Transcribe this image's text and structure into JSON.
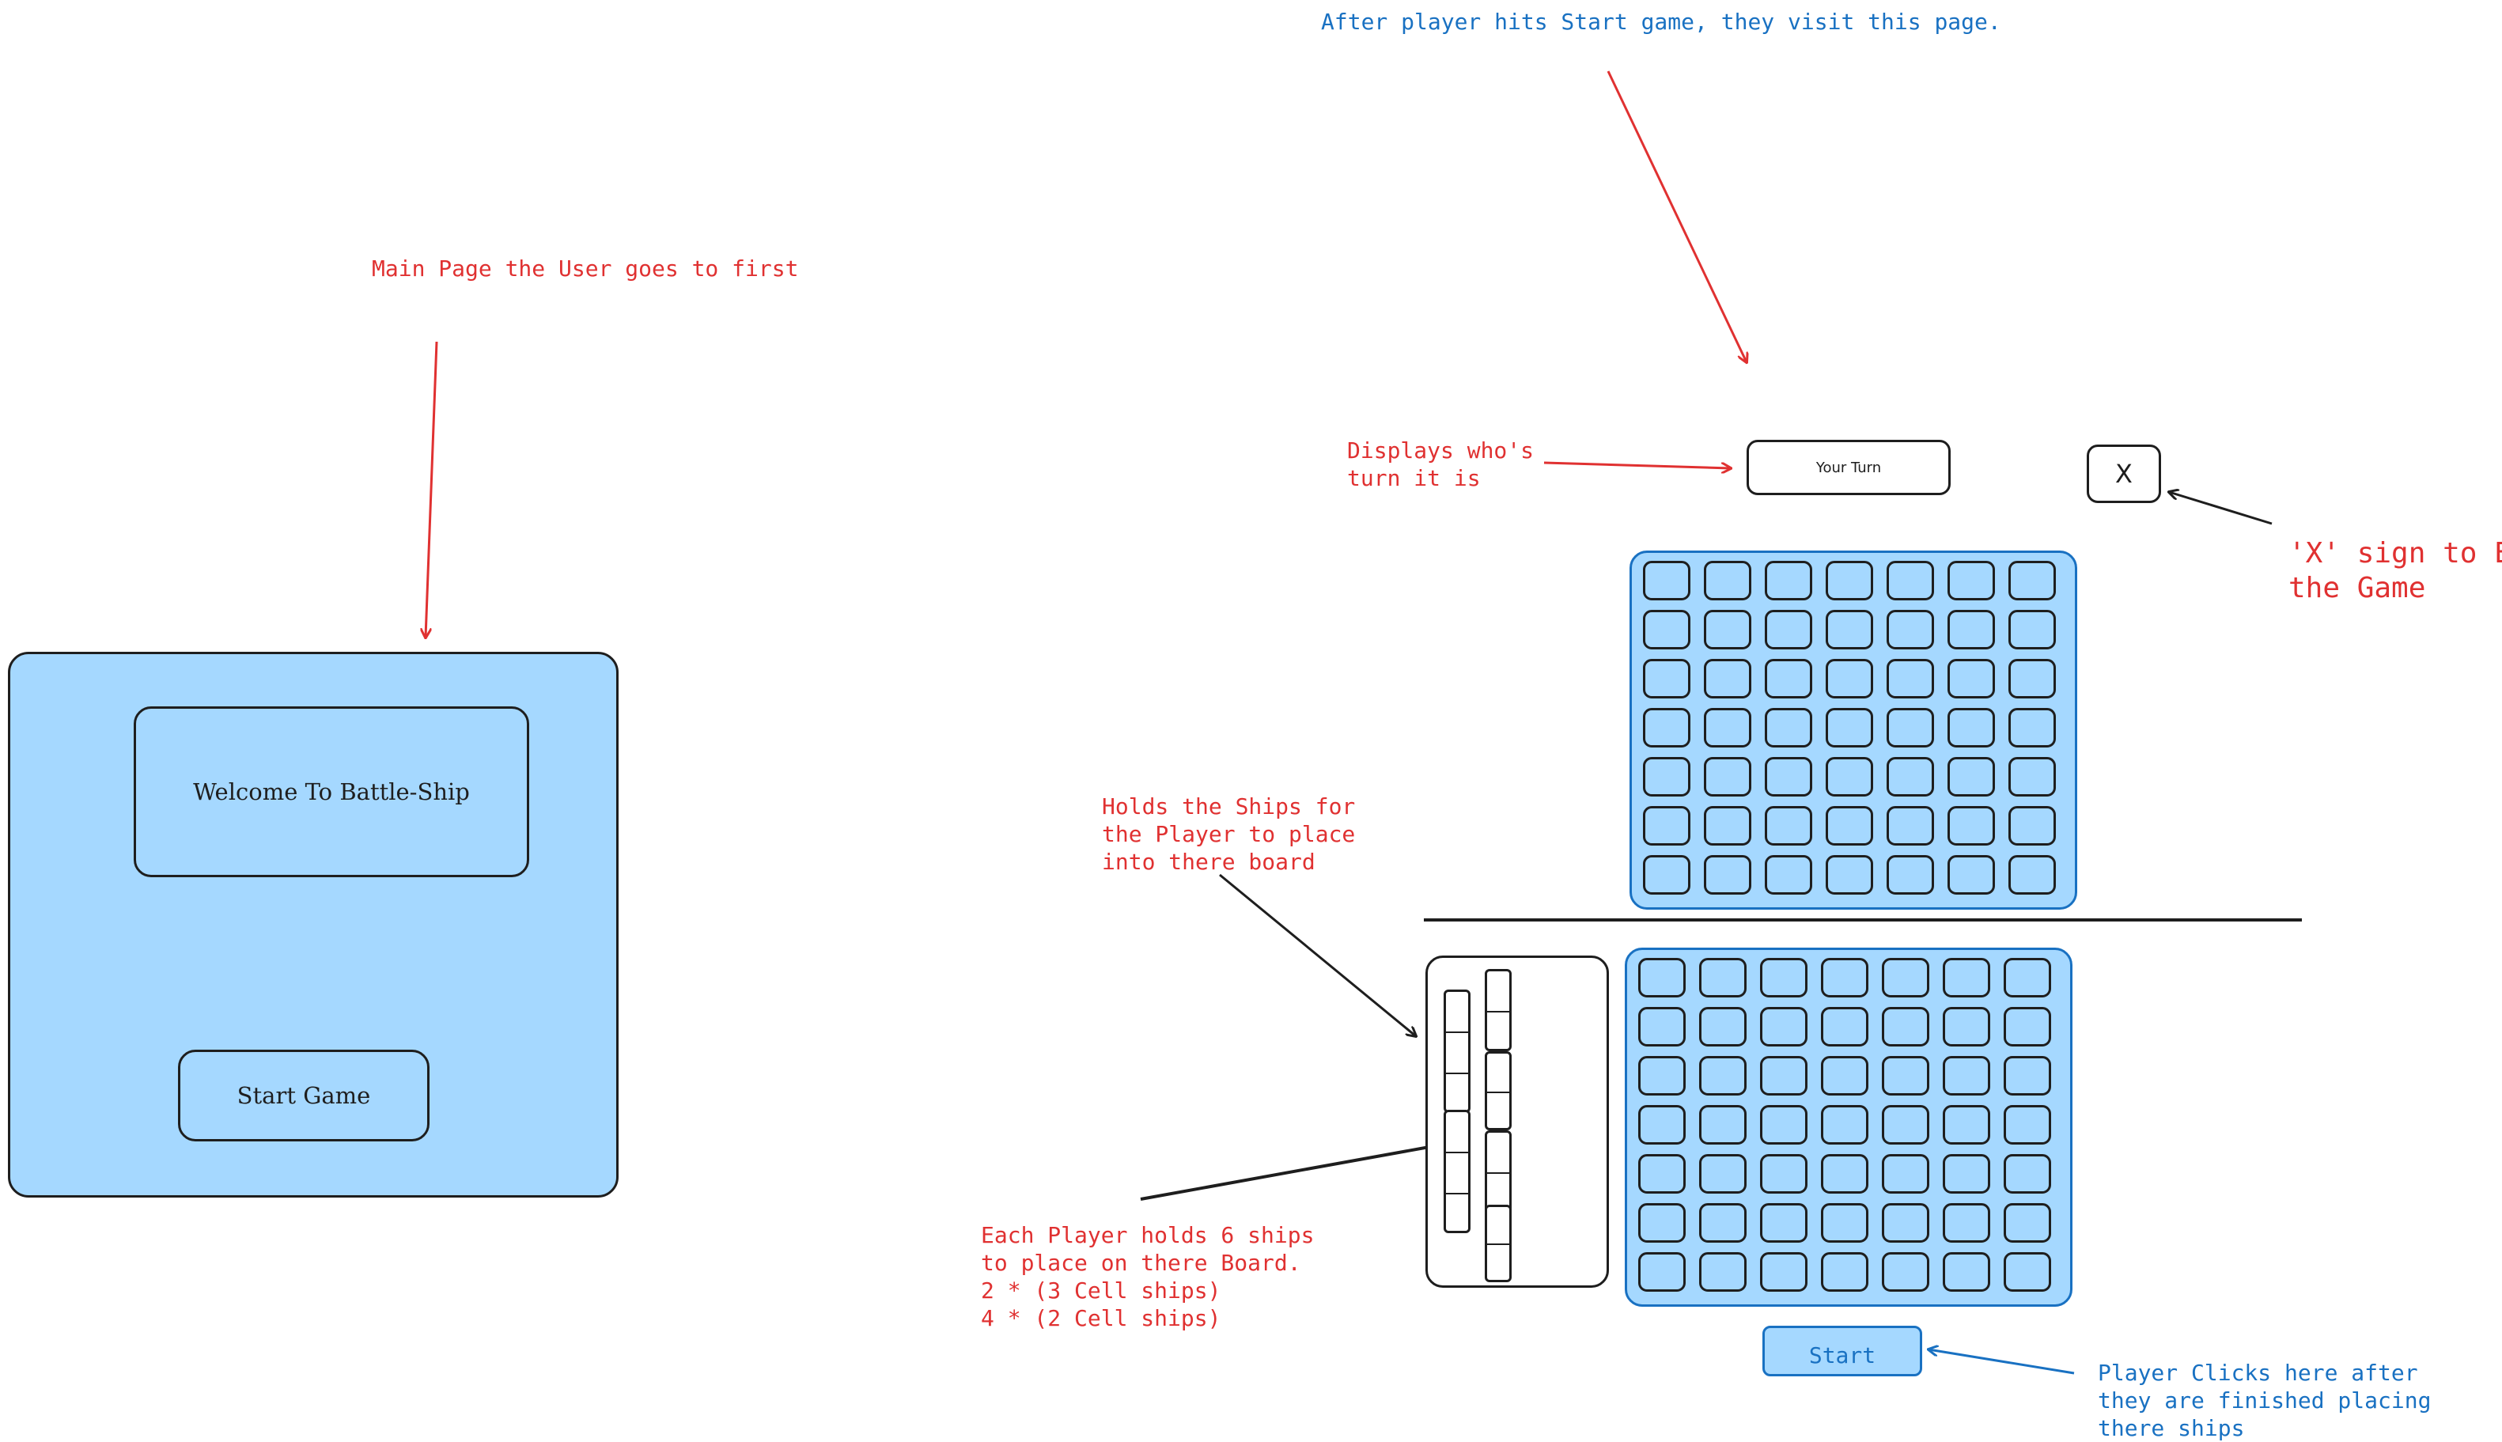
{
  "main_page": {
    "annotation": "Main Page the User goes to first",
    "welcome_text": "Welcome To Battle-Ship",
    "start_game_label": "Start Game"
  },
  "game_page": {
    "annotation_top": "After player hits Start game, they visit this page.",
    "turn_label": "Your Turn",
    "turn_annotation": "Displays who's\nturn it is",
    "close_label": "X",
    "close_annotation": "'X' sign to End\nthe Game",
    "ship_holder_annotation": "Holds the Ships for\nthe Player to place\ninto there board",
    "ships_annotation": "Each Player holds 6 ships\nto place on there Board.\n2 * (3 Cell ships)\n4 * (2 Cell ships)",
    "start_label": "Start",
    "start_annotation": "Player Clicks here after\nthey are finished placing\nthere ships"
  },
  "colors": {
    "panel_fill": "#a5d8ff",
    "board_border": "#1971c2",
    "annotation_red": "#e03131",
    "annotation_blue": "#1971c2",
    "ink": "#1e1e1e"
  },
  "boards": {
    "rows": 7,
    "cols": 7
  },
  "ship_holder": {
    "three_cell_ships": 2,
    "two_cell_ships": 4
  }
}
